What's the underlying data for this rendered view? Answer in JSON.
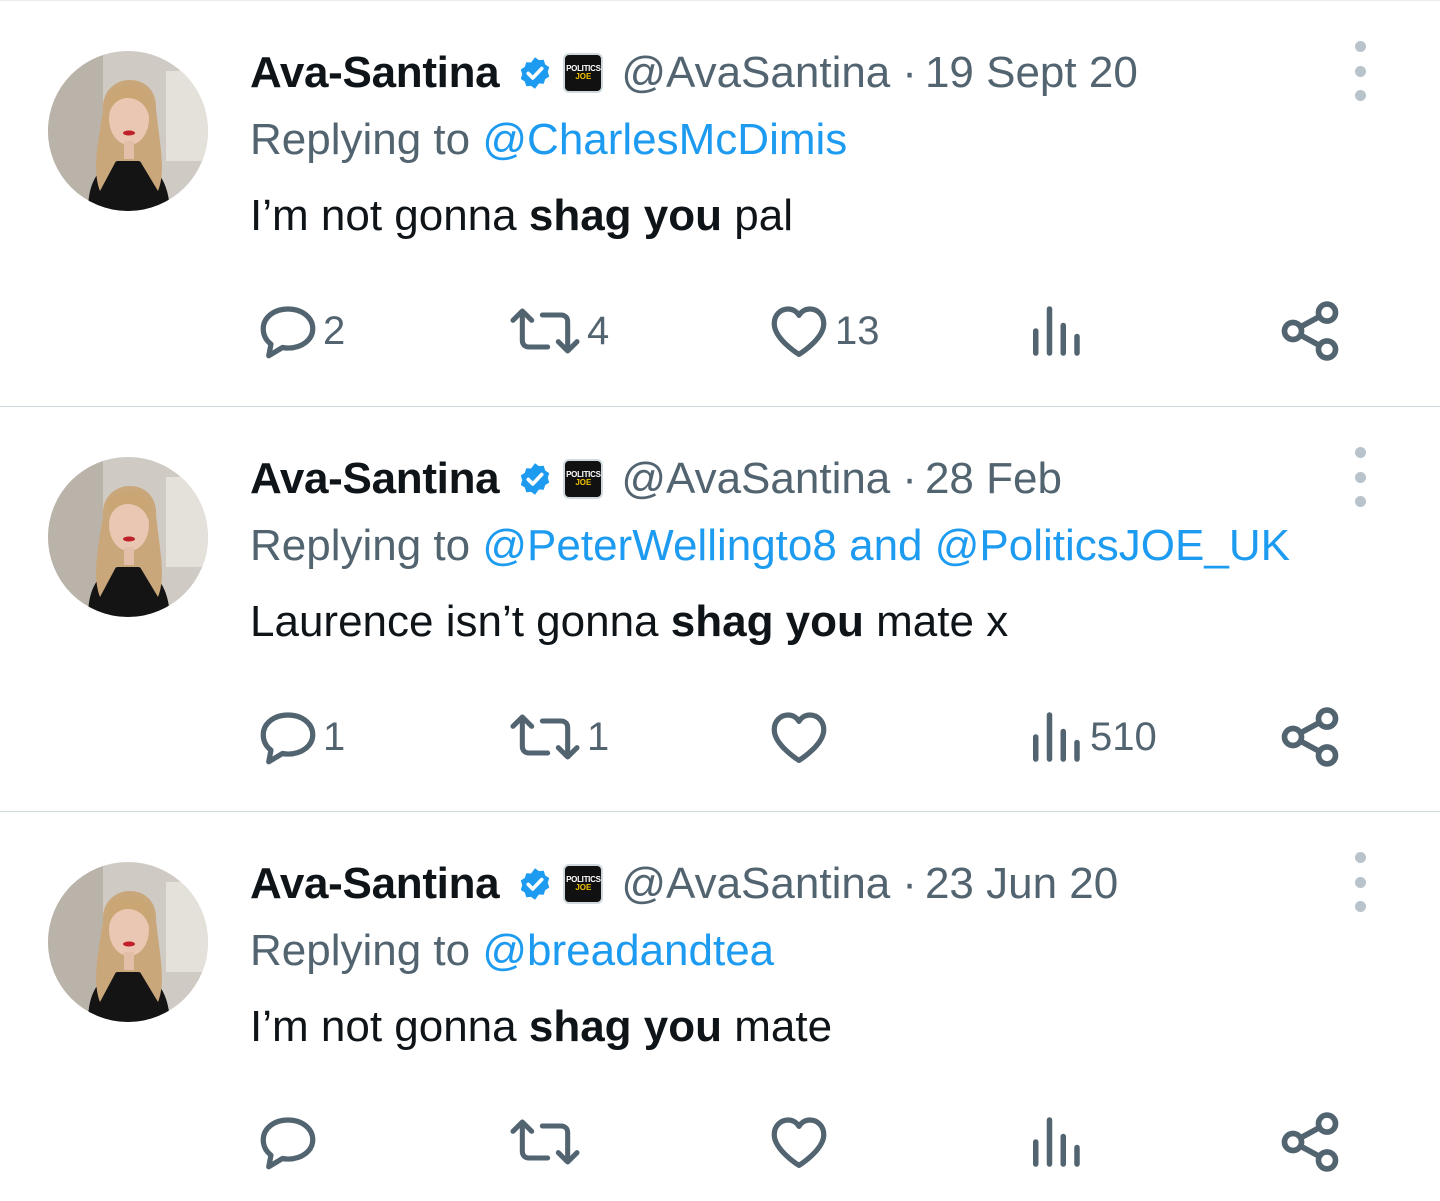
{
  "author": {
    "name": "Ava-Santina",
    "handle": "@AvaSantina",
    "affiliate_badge": {
      "line1": "POLITICS",
      "line2": "JOE"
    }
  },
  "colors": {
    "accent": "#1d9bf0",
    "text": "#0f1419",
    "muted": "#536471",
    "divider": "#cfd9de"
  },
  "icons": {
    "verified": "verified-badge-icon",
    "reply": "reply-bubble-icon",
    "retweet": "retweet-arrows-icon",
    "like": "heart-icon",
    "views": "bar-chart-icon",
    "share": "share-icon",
    "more": "vertical-dots-icon"
  },
  "tweets": [
    {
      "date": "19 Sept 20",
      "replying_prefix": "Replying to",
      "mention1": "@CharlesMcDimis",
      "and_text": "",
      "mention2": "",
      "text_before": "I’m not gonna",
      "text_bold": "shag you",
      "text_after": "pal",
      "reply_count": "2",
      "retweet_count": "4",
      "like_count": "13",
      "view_count": ""
    },
    {
      "date": "28 Feb",
      "replying_prefix": "Replying to",
      "mention1": "@PeterWellingto8",
      "and_text": "and",
      "mention2": "@PoliticsJOE_UK",
      "text_before": "Laurence isn’t gonna",
      "text_bold": "shag you",
      "text_after": "mate x",
      "reply_count": "1",
      "retweet_count": "1",
      "like_count": "",
      "view_count": "510"
    },
    {
      "date": "23 Jun 20",
      "replying_prefix": "Replying to",
      "mention1": "@breadandtea",
      "and_text": "",
      "mention2": "",
      "text_before": "I’m not gonna",
      "text_bold": "shag you",
      "text_after": "mate",
      "reply_count": "",
      "retweet_count": "",
      "like_count": "",
      "view_count": ""
    }
  ]
}
